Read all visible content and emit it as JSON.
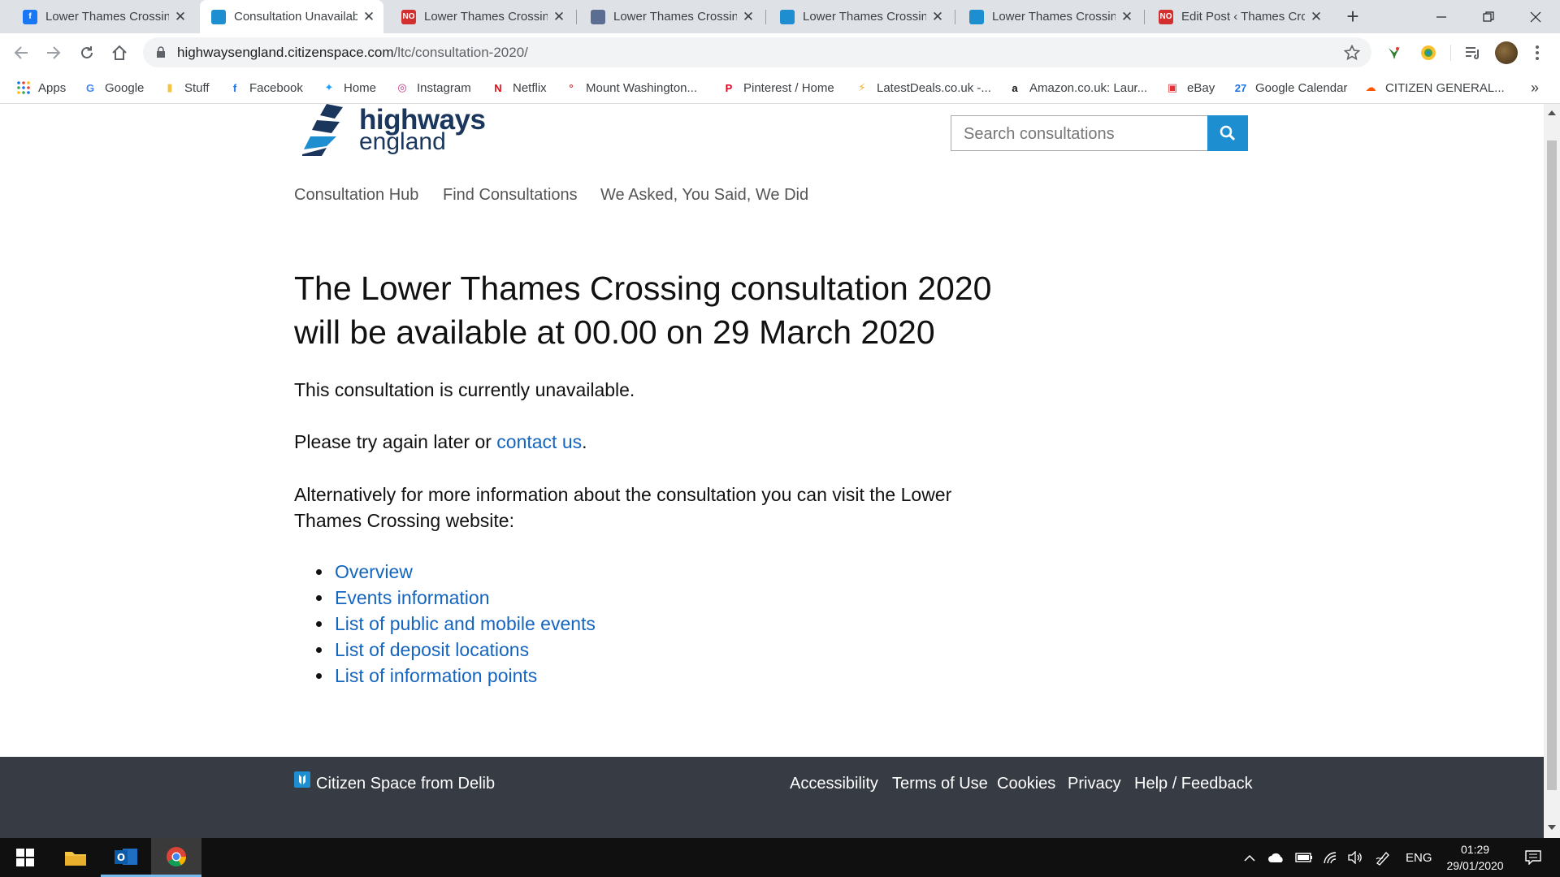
{
  "browser": {
    "tabs": [
      {
        "title": "Lower Thames Crossing",
        "favicon": "facebook-icon",
        "color": "#1877f2",
        "glyph": "f"
      },
      {
        "title": "Consultation Unavailable",
        "favicon": "citizen-space-icon",
        "color": "#1d8fd1",
        "glyph": "",
        "active": true
      },
      {
        "title": "Lower Thames Crossing",
        "favicon": "no-badge-icon",
        "color": "#d32f2f",
        "glyph": "NO"
      },
      {
        "title": "Lower Thames Crossing",
        "favicon": "site-icon",
        "color": "#5b6e91",
        "glyph": ""
      },
      {
        "title": "Lower Thames Crossing",
        "favicon": "citizen-space-icon",
        "color": "#1d8fd1",
        "glyph": ""
      },
      {
        "title": "Lower Thames Crossing",
        "favicon": "citizen-space-icon",
        "color": "#1d8fd1",
        "glyph": ""
      },
      {
        "title": "Edit Post ‹ Thames Crossing",
        "favicon": "no-badge-icon",
        "color": "#d32f2f",
        "glyph": "NO"
      }
    ],
    "new_tab_label": "+",
    "url_host": "highwaysengland.citizenspace.com",
    "url_path": "/ltc/consultation-2020/",
    "bookmarks": [
      {
        "label": "Apps",
        "icon": "apps-grid-icon"
      },
      {
        "label": "Google",
        "icon": "google-icon"
      },
      {
        "label": "Stuff",
        "icon": "folder-icon"
      },
      {
        "label": "Facebook",
        "icon": "facebook-icon"
      },
      {
        "label": "Home",
        "icon": "twitter-icon"
      },
      {
        "label": "Instagram",
        "icon": "instagram-icon"
      },
      {
        "label": "Netflix",
        "icon": "netflix-icon"
      },
      {
        "label": "Mount Washington...",
        "icon": "mount-washington-icon"
      },
      {
        "label": "Pinterest / Home",
        "icon": "pinterest-icon"
      },
      {
        "label": "LatestDeals.co.uk -...",
        "icon": "bolt-icon"
      },
      {
        "label": "Amazon.co.uk: Laur...",
        "icon": "amazon-icon"
      },
      {
        "label": "eBay",
        "icon": "ebay-icon"
      },
      {
        "label": "Google Calendar",
        "icon": "calendar-icon"
      },
      {
        "label": "CITIZEN GENERAL...",
        "icon": "soundcloud-icon"
      }
    ],
    "bookmarks_overflow": "»"
  },
  "site": {
    "logo_line1": "highways",
    "logo_line2": "england",
    "search_placeholder": "Search consultations",
    "nav": [
      "Consultation Hub",
      "Find Consultations",
      "We Asked, You Said, We Did"
    ]
  },
  "content": {
    "heading_line1": "The Lower Thames Crossing consultation 2020",
    "heading_line2": "will be available at 00.00 on 29 March 2020",
    "unavailable_text": "This consultation is currently unavailable.",
    "retry_prefix": "Please try again later or ",
    "retry_link": "contact us",
    "retry_suffix": ".",
    "alt_line1": "Alternatively for more information about the consultation you can visit the Lower",
    "alt_line2": "Thames Crossing website:",
    "links": [
      "Overview",
      "Events information",
      "List of public and mobile events",
      "List of deposit locations",
      "List of information points"
    ]
  },
  "footer": {
    "brand": "Citizen Space from Delib",
    "links": [
      "Accessibility",
      "Terms of Use",
      "Cookies",
      "Privacy",
      "Help / Feedback"
    ]
  },
  "taskbar": {
    "language": "ENG",
    "time": "01:29",
    "date": "29/01/2020"
  }
}
